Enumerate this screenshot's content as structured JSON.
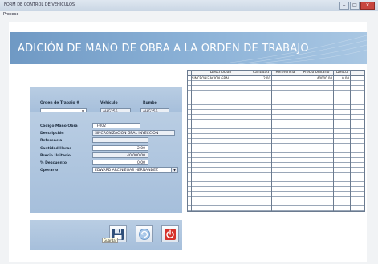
{
  "window": {
    "title": "FORM DE CONTROL DE VEHICULOS",
    "menu": "Proceso",
    "minimize": "–",
    "maximize": "□",
    "close": "×"
  },
  "page": {
    "title": "ADICIÓN DE MANO DE OBRA A LA ORDEN DE TRABAJO"
  },
  "order": {
    "order_label": "Orden de Trabajo #",
    "order_value": "",
    "vehicle_label": "Vehículo",
    "vehicle_value": "AHG256",
    "placa_label": "Rumbo",
    "placa_value": "AHG256"
  },
  "form": {
    "codigo_label": "Código Mano Obra",
    "codigo_value": "TF002",
    "descripcion_label": "Descripción",
    "descripcion_value": "SINCRONIZACION GRAL INYECCION",
    "referencia_label": "Referencia",
    "referencia_value": "",
    "cantidad_label": "Cantidad Horas",
    "cantidad_value": "2.00",
    "precio_label": "Precio Unitario",
    "precio_value": "40,000.00",
    "descuento_label": "% Descuento",
    "descuento_value": "0.00",
    "operario_label": "Operario",
    "operario_value": "EDWARD ARCINIEGAS HERNANDEZ"
  },
  "actions": {
    "save_tooltip": "Guardar",
    "save_icon": "floppy-disk-icon",
    "refresh_icon": "refresh-icon",
    "power_icon": "power-icon"
  },
  "grid": {
    "columns": [
      "Descripcion",
      "Cantidad",
      "Referencia",
      "Precio Unitario",
      "Descu"
    ],
    "rows": [
      {
        "descripcion": "SINCRONIZACION GRAL",
        "cantidad": "2.00",
        "referencia": "",
        "precio": "40000.00",
        "descuento": "0.00"
      }
    ]
  },
  "colors": {
    "banner": "#7ea6cf",
    "panel": "#b0c6df",
    "close": "#c8463f"
  }
}
